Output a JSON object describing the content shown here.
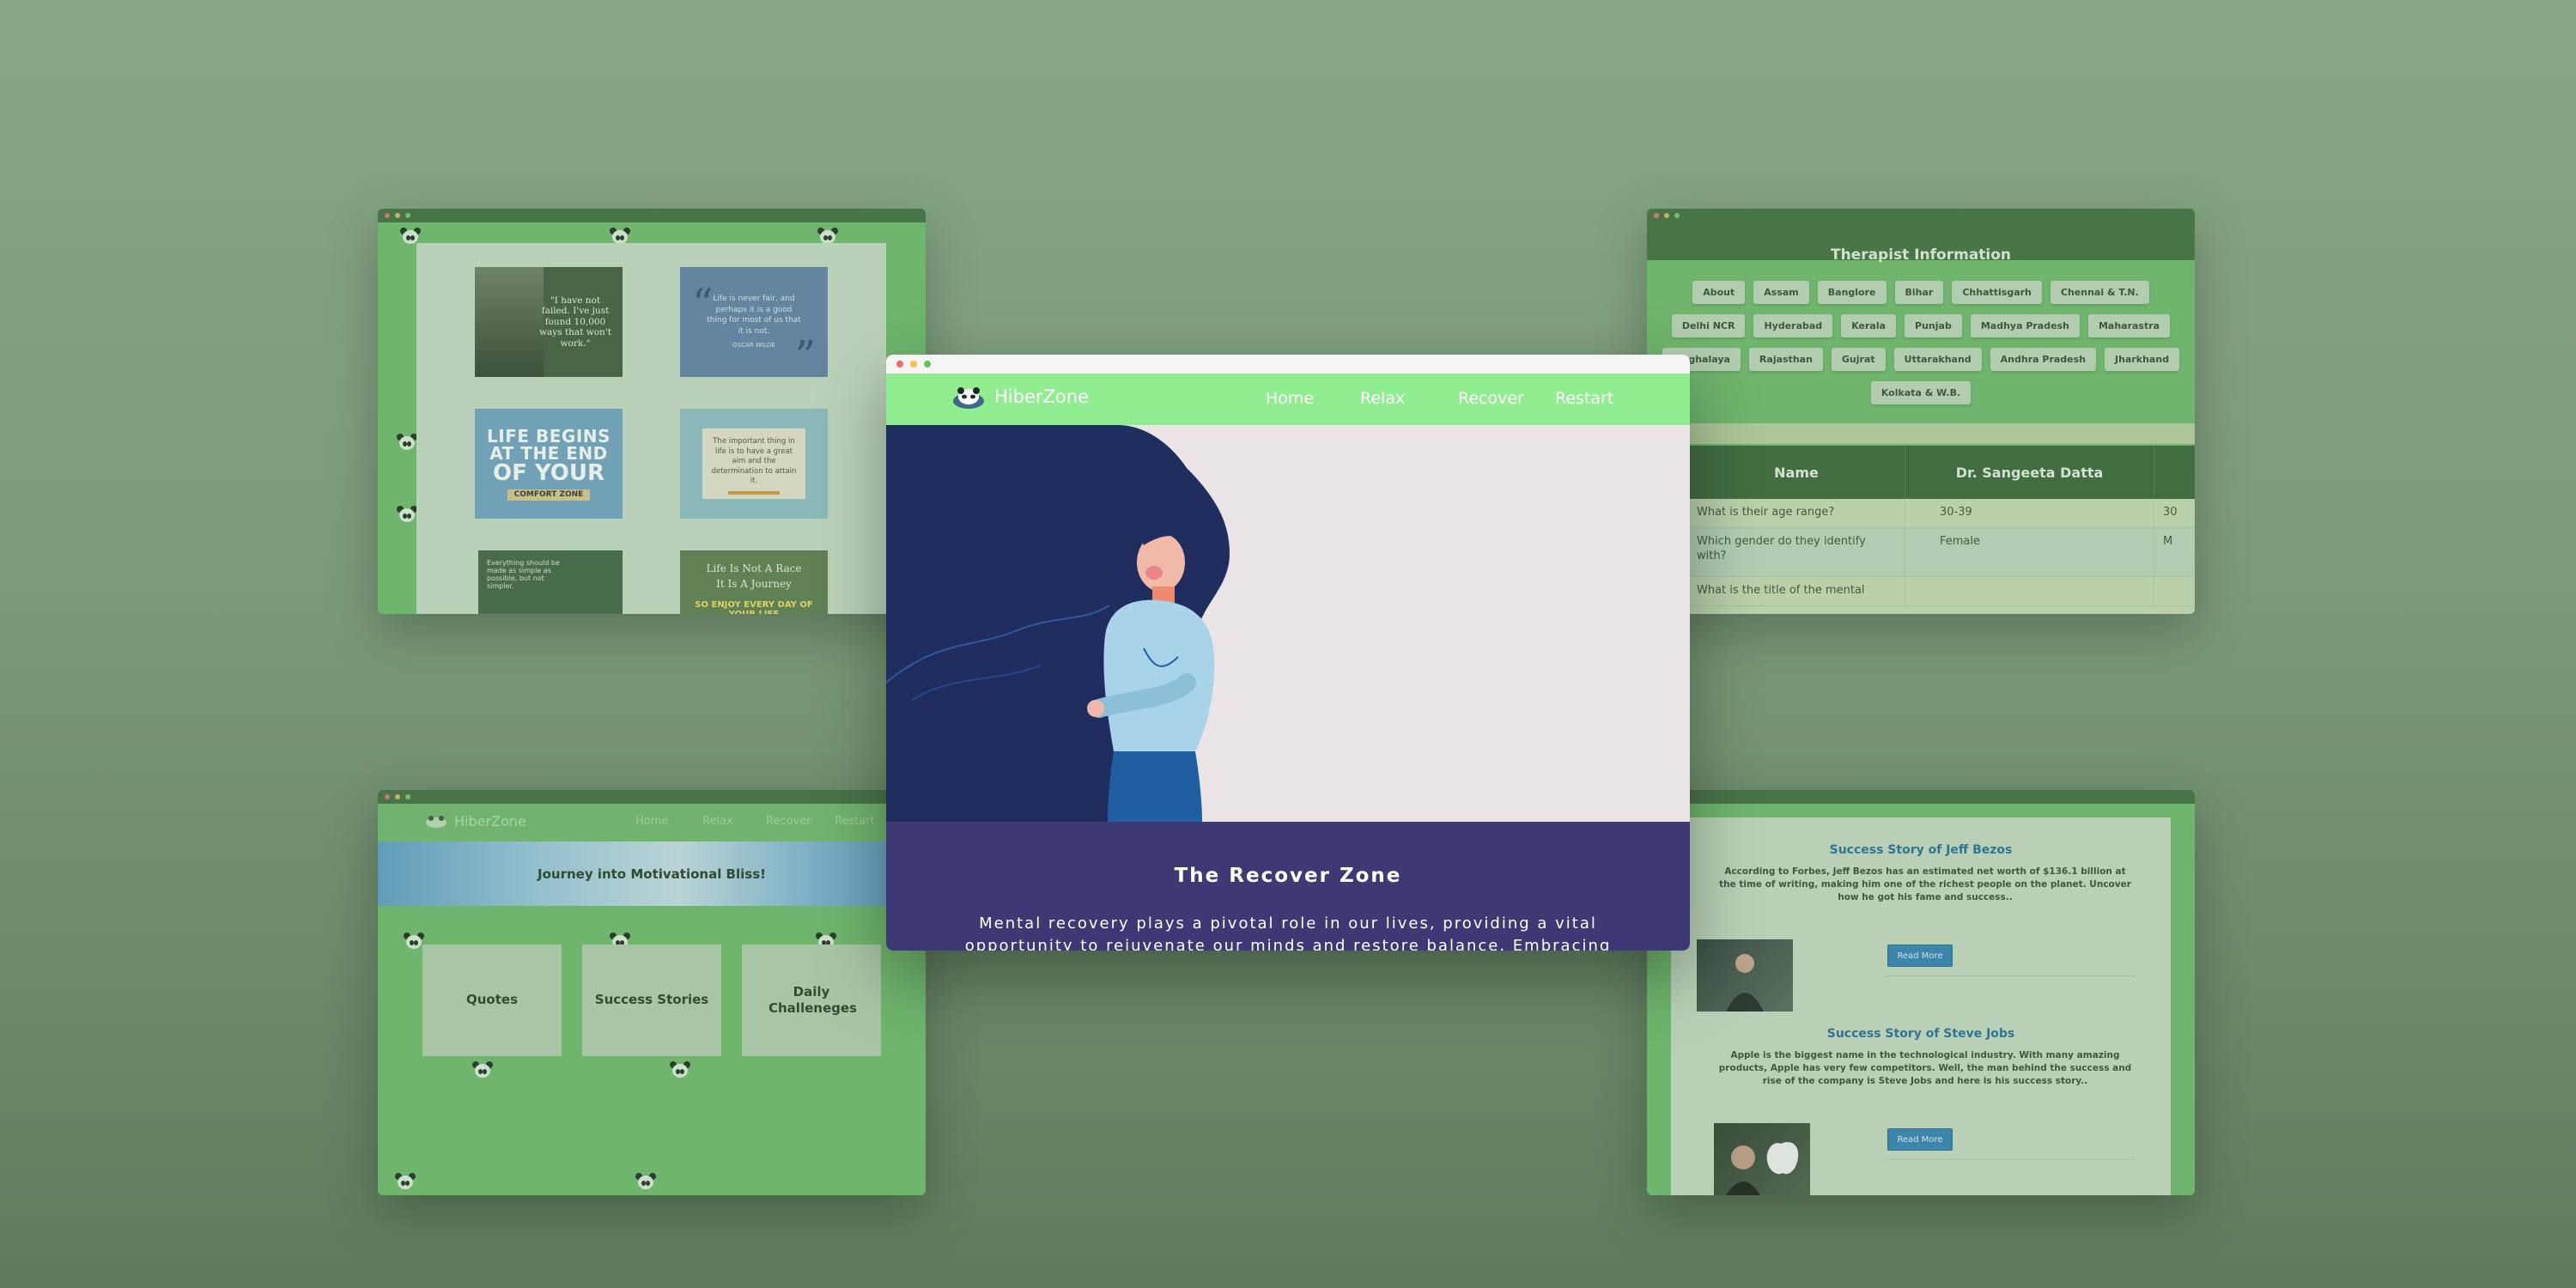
{
  "colors": {
    "background": "#7a9b79",
    "nav_green": "#90ee90",
    "panel_purple": "#3c3975",
    "dark_green": "#3d6d3c",
    "link_blue": "#1f6c99",
    "button_blue": "#2f7fb6"
  },
  "main": {
    "brand": "HiberZone",
    "brand_icon": "panda-logo-icon",
    "nav": [
      "Home",
      "Relax",
      "Recover",
      "Restart"
    ],
    "panel_title": "The Recover Zone",
    "panel_text": "Mental recovery plays a pivotal role in our lives, providing a vital opportunity to rejuvenate our minds and restore balance. Embracing"
  },
  "quotes_window": {
    "q1": "\"I have not failed. I've just found 10,000 ways that won't work.\"",
    "q2": "Life is never fair, and perhaps it is a good thing for most of us that it is not.",
    "q2_author": "OSCAR WILDE",
    "q3_line1": "LIFE BEGINS",
    "q3_line2": "AT THE END",
    "q3_line3": "OF YOUR",
    "q3_band": "COMFORT ZONE",
    "q4": "The important thing in life is to have a great aim and the determination to attain it.",
    "q5": "Everything should be made as simple as possible, but not simpler.",
    "q6_line1": "Life Is Not A Race",
    "q6_line2": "It Is A Journey",
    "q6_line3": "SO ENJOY EVERY DAY OF YOUR LIFE"
  },
  "therapist_window": {
    "title": "Therapist Information",
    "chips": [
      "About",
      "Assam",
      "Banglore",
      "Bihar",
      "Chhattisgarh",
      "Chennai & T.N.",
      "Delhi NCR",
      "Hyderabad",
      "Kerala",
      "Punjab",
      "Madhya Pradesh",
      "Maharastra",
      "Meghalaya",
      "Rajasthan",
      "Gujrat",
      "Uttarakhand",
      "Andhra Pradesh",
      "Jharkhand",
      "Kolkata & W.B."
    ],
    "table": {
      "headers": [
        "Name",
        "Dr. Sangeeta Datta"
      ],
      "rows": [
        {
          "q": "What is their age range?",
          "a": "30-39",
          "b": "30"
        },
        {
          "q": "Which gender do they identify with?",
          "a": "Female",
          "b": "M"
        },
        {
          "q": "What is the title of the mental",
          "a": "",
          "b": ""
        }
      ]
    }
  },
  "motivation_window": {
    "brand": "HiberZone",
    "nav": [
      "Home",
      "Relax",
      "Recover",
      "Restart"
    ],
    "hero": "Journey into Motivational Bliss!",
    "cards": [
      "Quotes",
      "Success Stories",
      "Daily Challeneges"
    ]
  },
  "stories_window": {
    "stories": [
      {
        "title": "Success Story of Jeff Bezos",
        "body": "According to Forbes, Jeff Bezos has an estimated net worth of $136.1 billion at the time of writing, making him one of the richest people on the planet. Uncover how he got his fame and success..",
        "button": "Read More"
      },
      {
        "title": "Success Story of Steve Jobs",
        "body": "Apple is the biggest name in the technological industry. With many amazing products, Apple has very few competitors. Well, the man behind the success and rise of the company is Steve Jobs and here is his success story..",
        "button": "Read More"
      }
    ]
  }
}
